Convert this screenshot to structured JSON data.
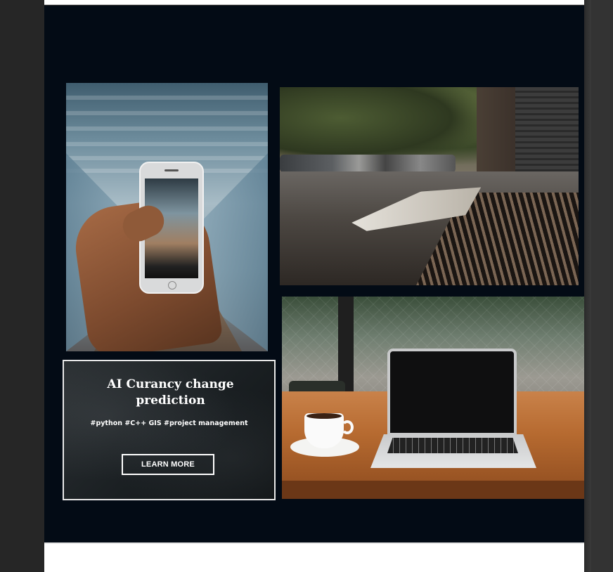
{
  "promo": {
    "title": "AI Curancy change prediction",
    "tags": "#python #C++ GIS #project management",
    "button_label": "LEARN MORE"
  },
  "images": [
    {
      "name": "hand-holding-phone-corridor"
    },
    {
      "name": "street-newspaper-grate"
    },
    {
      "name": "laptop-coffee-table"
    }
  ],
  "colors": {
    "hero_background": "#030b15",
    "page_background": "#262626",
    "card_border": "#e9e9e9",
    "text": "#ffffff"
  }
}
